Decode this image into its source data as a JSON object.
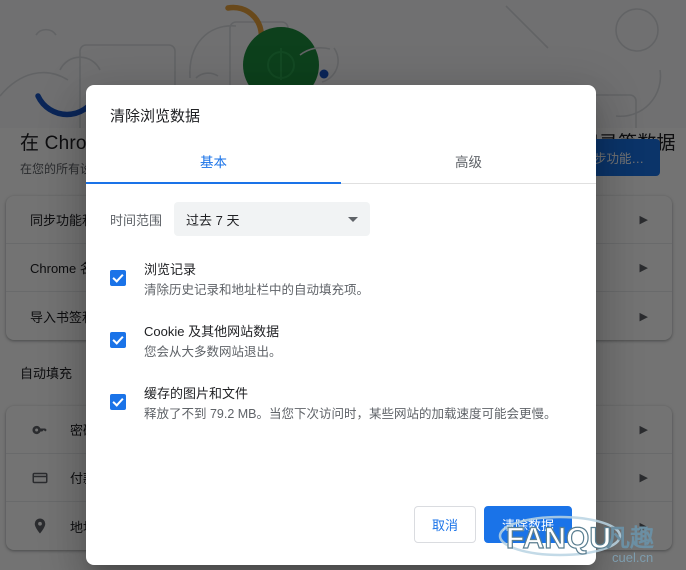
{
  "background": {
    "page_title": "在 Chrome 中登录后即可在所有设备上使用您的书签、密码、历史记录等数据",
    "page_subtitle": "在您的所有设备上使用您的 Chrome 数据",
    "sync_button_label": "开启同步功能…",
    "sync_card_rows": [
      {
        "label": "同步功能和 Google 服务",
        "icon": "none",
        "chevron": "chevron-right-icon"
      },
      {
        "label": "Chrome 名称",
        "icon": "none",
        "chevron": "chevron-right-icon"
      },
      {
        "label": "导入书签和设置",
        "icon": "none",
        "chevron": "chevron-right-icon"
      }
    ],
    "autofill_section_title": "自动填充",
    "autofill_rows": [
      {
        "label": "密码",
        "icon": "key-icon",
        "chevron": "chevron-right-icon"
      },
      {
        "label": "付款方式",
        "icon": "credit-card-icon",
        "chevron": "chevron-right-icon"
      },
      {
        "label": "地址和其他信息",
        "icon": "location-pin-icon",
        "chevron": "chevron-right-icon"
      }
    ],
    "hero_illustration": {
      "green_circle_color": "#1e8e3e",
      "yellow_arc_color": "#e8a33d",
      "blue_arc_color": "#1a56c4",
      "blue_dot_color": "#1a56c4",
      "outline_color": "#dadce0",
      "background_color": "#f8f9fa"
    }
  },
  "dialog": {
    "title": "清除浏览数据",
    "tabs": [
      {
        "label": "基本",
        "active": true
      },
      {
        "label": "高级",
        "active": false
      }
    ],
    "time_range": {
      "label": "时间范围",
      "selected": "过去 7 天",
      "caret_icon": "chevron-down-icon"
    },
    "items": [
      {
        "title": "浏览记录",
        "desc": "清除历史记录和地址栏中的自动填充项。",
        "checked": true
      },
      {
        "title": "Cookie 及其他网站数据",
        "desc": "您会从大多数网站退出。",
        "checked": true
      },
      {
        "title": "缓存的图片和文件",
        "desc": "释放了不到 79.2 MB。当您下次访问时，某些网站的加载速度可能会更慢。",
        "checked": true
      }
    ],
    "footer": {
      "cancel_label": "取消",
      "confirm_label": "清除数据"
    }
  },
  "watermark": {
    "main_text": "FANQU",
    "cjk_text": "凡趣",
    "sub_text": "cuel.cn"
  },
  "colors": {
    "accent": "#1a73e8",
    "text_primary": "#202124",
    "text_secondary": "#5f6368",
    "divider": "#e0e0e0",
    "field_bg": "#f1f3f4"
  }
}
